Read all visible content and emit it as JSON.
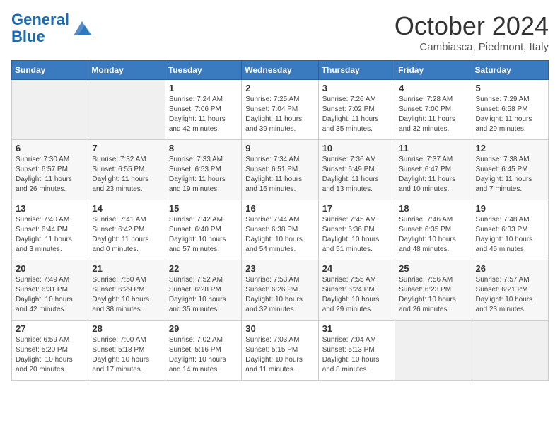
{
  "header": {
    "logo_line1": "General",
    "logo_line2": "Blue",
    "month": "October 2024",
    "location": "Cambiasca, Piedmont, Italy"
  },
  "weekdays": [
    "Sunday",
    "Monday",
    "Tuesday",
    "Wednesday",
    "Thursday",
    "Friday",
    "Saturday"
  ],
  "weeks": [
    [
      {
        "day": "",
        "content": ""
      },
      {
        "day": "",
        "content": ""
      },
      {
        "day": "1",
        "content": "Sunrise: 7:24 AM\nSunset: 7:06 PM\nDaylight: 11 hours and 42 minutes."
      },
      {
        "day": "2",
        "content": "Sunrise: 7:25 AM\nSunset: 7:04 PM\nDaylight: 11 hours and 39 minutes."
      },
      {
        "day": "3",
        "content": "Sunrise: 7:26 AM\nSunset: 7:02 PM\nDaylight: 11 hours and 35 minutes."
      },
      {
        "day": "4",
        "content": "Sunrise: 7:28 AM\nSunset: 7:00 PM\nDaylight: 11 hours and 32 minutes."
      },
      {
        "day": "5",
        "content": "Sunrise: 7:29 AM\nSunset: 6:58 PM\nDaylight: 11 hours and 29 minutes."
      }
    ],
    [
      {
        "day": "6",
        "content": "Sunrise: 7:30 AM\nSunset: 6:57 PM\nDaylight: 11 hours and 26 minutes."
      },
      {
        "day": "7",
        "content": "Sunrise: 7:32 AM\nSunset: 6:55 PM\nDaylight: 11 hours and 23 minutes."
      },
      {
        "day": "8",
        "content": "Sunrise: 7:33 AM\nSunset: 6:53 PM\nDaylight: 11 hours and 19 minutes."
      },
      {
        "day": "9",
        "content": "Sunrise: 7:34 AM\nSunset: 6:51 PM\nDaylight: 11 hours and 16 minutes."
      },
      {
        "day": "10",
        "content": "Sunrise: 7:36 AM\nSunset: 6:49 PM\nDaylight: 11 hours and 13 minutes."
      },
      {
        "day": "11",
        "content": "Sunrise: 7:37 AM\nSunset: 6:47 PM\nDaylight: 11 hours and 10 minutes."
      },
      {
        "day": "12",
        "content": "Sunrise: 7:38 AM\nSunset: 6:45 PM\nDaylight: 11 hours and 7 minutes."
      }
    ],
    [
      {
        "day": "13",
        "content": "Sunrise: 7:40 AM\nSunset: 6:44 PM\nDaylight: 11 hours and 3 minutes."
      },
      {
        "day": "14",
        "content": "Sunrise: 7:41 AM\nSunset: 6:42 PM\nDaylight: 11 hours and 0 minutes."
      },
      {
        "day": "15",
        "content": "Sunrise: 7:42 AM\nSunset: 6:40 PM\nDaylight: 10 hours and 57 minutes."
      },
      {
        "day": "16",
        "content": "Sunrise: 7:44 AM\nSunset: 6:38 PM\nDaylight: 10 hours and 54 minutes."
      },
      {
        "day": "17",
        "content": "Sunrise: 7:45 AM\nSunset: 6:36 PM\nDaylight: 10 hours and 51 minutes."
      },
      {
        "day": "18",
        "content": "Sunrise: 7:46 AM\nSunset: 6:35 PM\nDaylight: 10 hours and 48 minutes."
      },
      {
        "day": "19",
        "content": "Sunrise: 7:48 AM\nSunset: 6:33 PM\nDaylight: 10 hours and 45 minutes."
      }
    ],
    [
      {
        "day": "20",
        "content": "Sunrise: 7:49 AM\nSunset: 6:31 PM\nDaylight: 10 hours and 42 minutes."
      },
      {
        "day": "21",
        "content": "Sunrise: 7:50 AM\nSunset: 6:29 PM\nDaylight: 10 hours and 38 minutes."
      },
      {
        "day": "22",
        "content": "Sunrise: 7:52 AM\nSunset: 6:28 PM\nDaylight: 10 hours and 35 minutes."
      },
      {
        "day": "23",
        "content": "Sunrise: 7:53 AM\nSunset: 6:26 PM\nDaylight: 10 hours and 32 minutes."
      },
      {
        "day": "24",
        "content": "Sunrise: 7:55 AM\nSunset: 6:24 PM\nDaylight: 10 hours and 29 minutes."
      },
      {
        "day": "25",
        "content": "Sunrise: 7:56 AM\nSunset: 6:23 PM\nDaylight: 10 hours and 26 minutes."
      },
      {
        "day": "26",
        "content": "Sunrise: 7:57 AM\nSunset: 6:21 PM\nDaylight: 10 hours and 23 minutes."
      }
    ],
    [
      {
        "day": "27",
        "content": "Sunrise: 6:59 AM\nSunset: 5:20 PM\nDaylight: 10 hours and 20 minutes."
      },
      {
        "day": "28",
        "content": "Sunrise: 7:00 AM\nSunset: 5:18 PM\nDaylight: 10 hours and 17 minutes."
      },
      {
        "day": "29",
        "content": "Sunrise: 7:02 AM\nSunset: 5:16 PM\nDaylight: 10 hours and 14 minutes."
      },
      {
        "day": "30",
        "content": "Sunrise: 7:03 AM\nSunset: 5:15 PM\nDaylight: 10 hours and 11 minutes."
      },
      {
        "day": "31",
        "content": "Sunrise: 7:04 AM\nSunset: 5:13 PM\nDaylight: 10 hours and 8 minutes."
      },
      {
        "day": "",
        "content": ""
      },
      {
        "day": "",
        "content": ""
      }
    ]
  ]
}
